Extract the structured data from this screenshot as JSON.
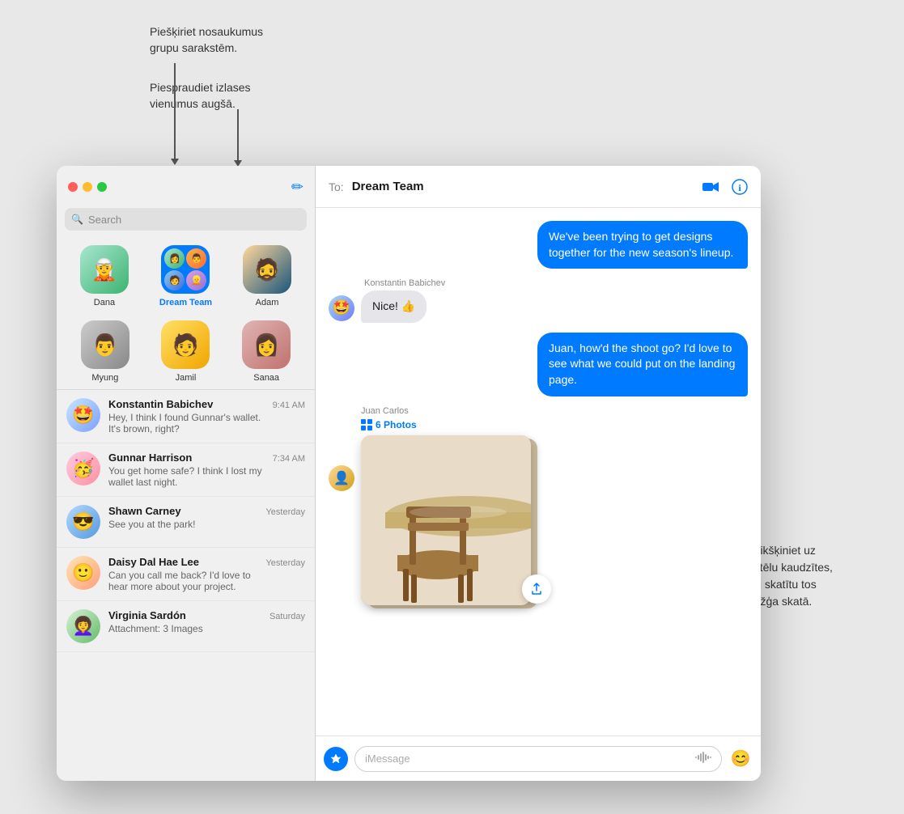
{
  "annotations": {
    "top_line1": "Piešķiriet nosaukumus",
    "top_line2": "grupu sarakstēm.",
    "top_line3": "Piespraudiet izlases",
    "top_line4": "vienumus augšā.",
    "right_line1": "Klikšķiniet uz",
    "right_line2": "attēlu kaudzītes,",
    "right_line3": "lai skatītu tos",
    "right_line4": "režģa skatā."
  },
  "titlebar": {
    "compose_label": "✏",
    "traffic_lights": [
      "red",
      "yellow",
      "green"
    ]
  },
  "search": {
    "placeholder": "Search"
  },
  "pinned": {
    "row1": [
      {
        "id": "dana",
        "name": "Dana",
        "emoji": "🧝"
      },
      {
        "id": "dream-team",
        "name": "Dream Team",
        "selected": true
      },
      {
        "id": "adam",
        "name": "Adam",
        "emoji": "🧔"
      }
    ],
    "row2": [
      {
        "id": "myung",
        "name": "Myung",
        "emoji": "👨"
      },
      {
        "id": "jamil",
        "name": "Jamil",
        "emoji": "🧑"
      },
      {
        "id": "sanaa",
        "name": "Sanaa",
        "emoji": "👩"
      }
    ]
  },
  "messages_list": [
    {
      "id": "konstantin",
      "name": "Konstantin Babichev",
      "time": "9:41 AM",
      "preview": "Hey, I think I found Gunnar's wallet. It's brown, right?",
      "emoji": "🤩"
    },
    {
      "id": "gunnar",
      "name": "Gunnar Harrison",
      "time": "7:34 AM",
      "preview": "You get home safe? I think I lost my wallet last night.",
      "emoji": "🥳"
    },
    {
      "id": "shawn",
      "name": "Shawn Carney",
      "time": "Yesterday",
      "preview": "See you at the park!",
      "emoji": "😎"
    },
    {
      "id": "daisy",
      "name": "Daisy Dal Hae Lee",
      "time": "Yesterday",
      "preview": "Can you call me back? I'd love to hear more about your project.",
      "emoji": "🙂"
    },
    {
      "id": "virginia",
      "name": "Virginia Sardón",
      "time": "Saturday",
      "preview": "Attachment: 3 Images",
      "emoji": "👩‍🦱"
    }
  ],
  "chat": {
    "to_label": "To:",
    "recipient": "Dream Team",
    "messages": [
      {
        "id": "msg1",
        "type": "outgoing",
        "text": "We've been trying to get designs together for the new season's lineup."
      },
      {
        "id": "msg2",
        "type": "incoming",
        "sender": "Konstantin Babichev",
        "text": "Nice! 👍"
      },
      {
        "id": "msg3",
        "type": "outgoing",
        "text": "Juan, how'd the shoot go? I'd love to see what we could put on the landing page."
      },
      {
        "id": "msg4",
        "type": "photo",
        "sender": "Juan Carlos",
        "photo_count": "6 Photos"
      }
    ],
    "input_placeholder": "iMessage"
  }
}
